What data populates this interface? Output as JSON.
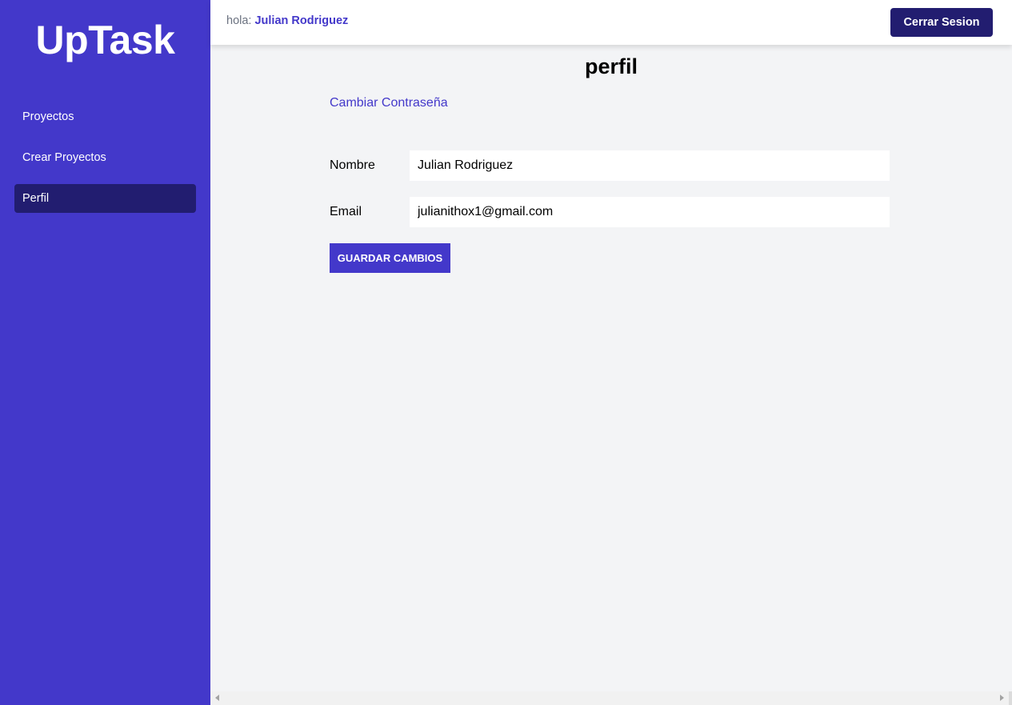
{
  "sidebar": {
    "logo": "UpTask",
    "items": [
      {
        "label": "Proyectos"
      },
      {
        "label": "Crear Proyectos"
      },
      {
        "label": "Perfil",
        "active": true
      }
    ]
  },
  "header": {
    "greeting_prefix": "hola:",
    "user_name": "Julian Rodriguez",
    "logout_label": "Cerrar Sesion"
  },
  "main": {
    "title": "perfil",
    "change_password_link": "Cambiar Contraseña",
    "form": {
      "name_label": "Nombre",
      "name_value": "Julian Rodriguez",
      "email_label": "Email",
      "email_value": "julianithox1@gmail.com",
      "save_label": "GUARDAR CAMBIOS"
    }
  },
  "colors": {
    "brand": "#4338ca",
    "brand_dark": "#221d70",
    "background": "#f3f4f6"
  }
}
